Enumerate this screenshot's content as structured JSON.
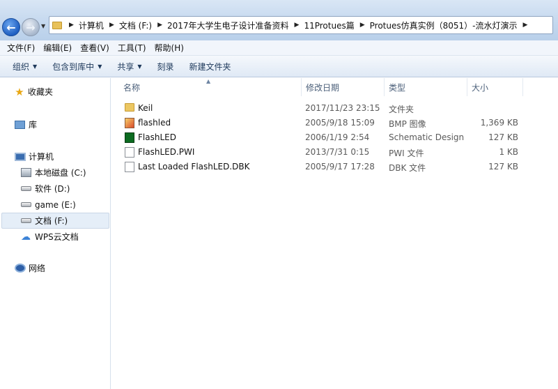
{
  "address_bar": {
    "crumbs": [
      "计算机",
      "文档 (F:)",
      "2017年大学生电子设计准备资料",
      "11Protues篇",
      "Protues仿真实例（8051）-流水灯演示"
    ]
  },
  "menu": [
    "文件(F)",
    "编辑(E)",
    "查看(V)",
    "工具(T)",
    "帮助(H)"
  ],
  "commands": {
    "organize": "组织",
    "include_in_library": "包含到库中",
    "share": "共享",
    "burn": "刻录",
    "new_folder": "新建文件夹"
  },
  "nav": {
    "favorites": "收藏夹",
    "libraries": "库",
    "computer": "计算机",
    "drive_c": "本地磁盘 (C:)",
    "drive_d": "软件 (D:)",
    "drive_e": "game (E:)",
    "drive_f": "文档 (F:)",
    "wps_cloud": "WPS云文档",
    "network": "网络"
  },
  "columns": {
    "name": "名称",
    "modified": "修改日期",
    "type": "类型",
    "size": "大小"
  },
  "files": [
    {
      "name": "Keil",
      "modified": "2017/11/23 23:15",
      "type": "文件夹",
      "size": "",
      "icon": "folder-icon"
    },
    {
      "name": "flashled",
      "modified": "2005/9/18 15:09",
      "type": "BMP 图像",
      "size": "1,369 KB",
      "icon": "bmp-image-icon"
    },
    {
      "name": "FlashLED",
      "modified": "2006/1/19 2:54",
      "type": "Schematic Design",
      "size": "127 KB",
      "icon": "schematic-design-icon"
    },
    {
      "name": "FlashLED.PWI",
      "modified": "2013/7/31 0:15",
      "type": "PWI 文件",
      "size": "1 KB",
      "icon": "document-icon"
    },
    {
      "name": "Last Loaded FlashLED.DBK",
      "modified": "2005/9/17 17:28",
      "type": "DBK 文件",
      "size": "127 KB",
      "icon": "document-icon"
    }
  ]
}
